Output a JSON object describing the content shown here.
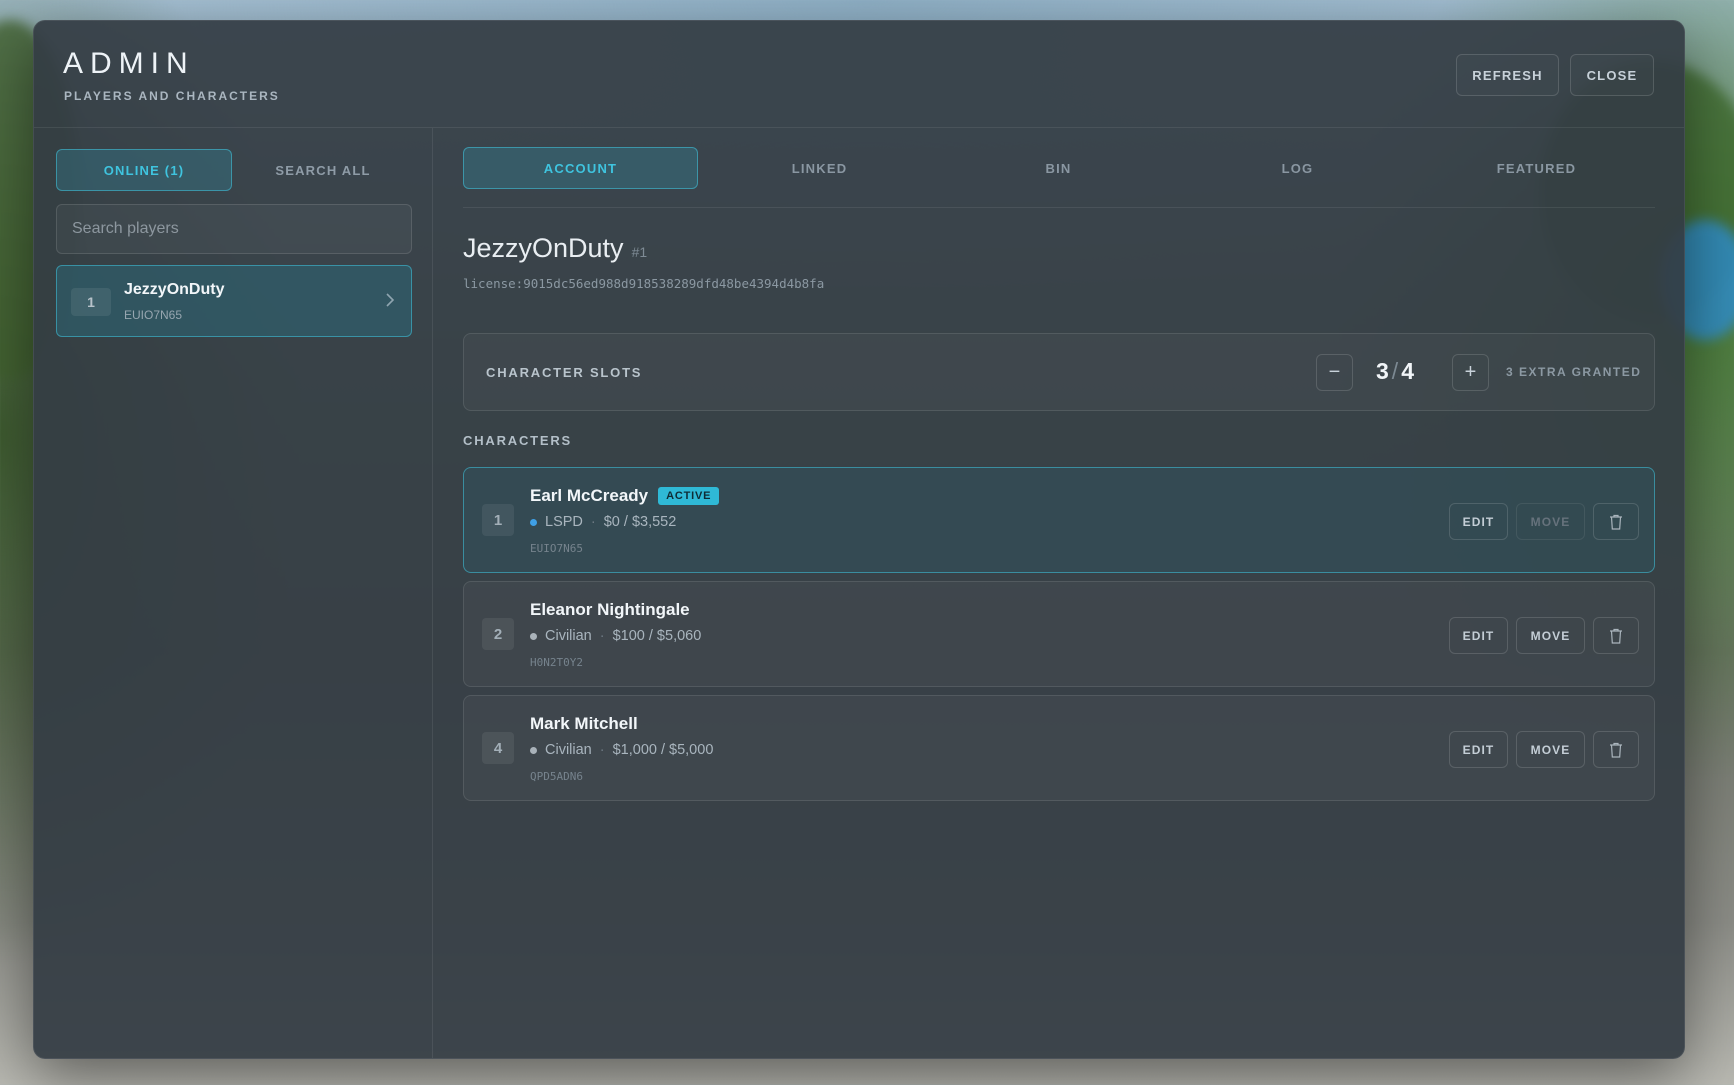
{
  "header": {
    "title": "ADMIN",
    "subtitle": "PLAYERS AND CHARACTERS",
    "refresh_label": "REFRESH",
    "close_label": "CLOSE"
  },
  "sidebar": {
    "tabs": [
      {
        "label": "ONLINE (1)",
        "active": true
      },
      {
        "label": "SEARCH ALL",
        "active": false
      }
    ],
    "search_placeholder": "Search players",
    "players": [
      {
        "num": "1",
        "name": "JezzyOnDuty",
        "id": "EUIO7N65"
      }
    ]
  },
  "main": {
    "tabs": [
      {
        "label": "ACCOUNT",
        "active": true
      },
      {
        "label": "LINKED",
        "active": false
      },
      {
        "label": "BIN",
        "active": false
      },
      {
        "label": "LOG",
        "active": false
      },
      {
        "label": "FEATURED",
        "active": false
      }
    ],
    "account": {
      "name": "JezzyOnDuty",
      "number": "#1",
      "license": "license:9015dc56ed988d918538289dfd48be4394d4b8fa"
    },
    "slots": {
      "label": "CHARACTER SLOTS",
      "minus": "−",
      "plus": "+",
      "used": "3",
      "sep": "/",
      "total": "4",
      "extra": "3 EXTRA GRANTED"
    },
    "characters_label": "CHARACTERS",
    "characters": [
      {
        "num": "1",
        "name": "Earl McCready",
        "badge": "ACTIVE",
        "job": "LSPD",
        "job_color": "#3fa0e6",
        "money": "$0 / $3,552",
        "id": "EUIO7N65",
        "edit": "EDIT",
        "move": "MOVE",
        "move_disabled": true,
        "active": true
      },
      {
        "num": "2",
        "name": "Eleanor Nightingale",
        "badge": "",
        "job": "Civilian",
        "job_color": "#a9b2b9",
        "money": "$100 / $5,060",
        "id": "H0N2T0Y2",
        "edit": "EDIT",
        "move": "MOVE",
        "move_disabled": false,
        "active": false
      },
      {
        "num": "4",
        "name": "Mark Mitchell",
        "badge": "",
        "job": "Civilian",
        "job_color": "#a9b2b9",
        "money": "$1,000 / $5,000",
        "id": "QPD5ADN6",
        "edit": "EDIT",
        "move": "MOVE",
        "move_disabled": false,
        "active": false
      }
    ]
  },
  "icons": {
    "chevron": "chevron-right-icon",
    "trash": "trash-icon"
  },
  "colors": {
    "accent": "#3fc4df",
    "panel": "#343c44"
  }
}
